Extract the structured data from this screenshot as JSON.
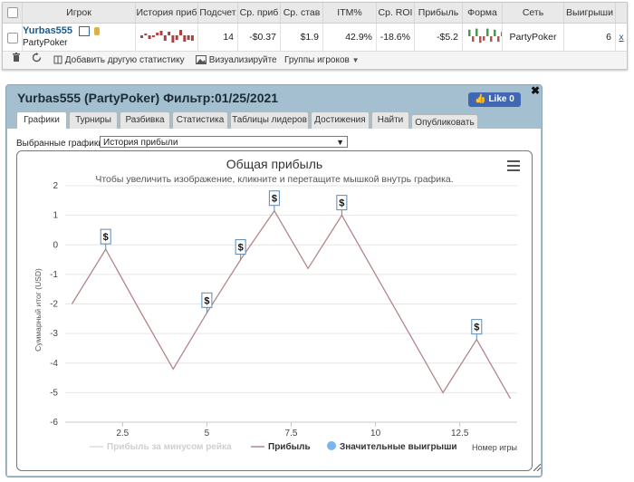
{
  "stats_table": {
    "headers": [
      "Игрок",
      "История приб",
      "Подсчет",
      "Ср. приб",
      "Ср. став",
      "ITM%",
      "Ср. ROI",
      "Прибыль",
      "Форма",
      "Сеть",
      "Выигрыши"
    ],
    "row": {
      "player_name": "Yurbas555",
      "player_network": "PartyPoker",
      "count": "14",
      "avg_profit": "-$0.37",
      "avg_stake": "$1.9",
      "itm": "42.9%",
      "avg_roi": "-18.6%",
      "profit": "-$5.2",
      "network": "PartyPoker",
      "wins": "6",
      "remove": "x"
    },
    "spark_history": [
      -0.3,
      0.2,
      -0.4,
      -0.2,
      0.3,
      0.5,
      -0.6,
      0.4,
      -0.8,
      -0.5,
      0.6,
      -0.7,
      -0.5,
      -0.6
    ],
    "form_bars": [
      0.6,
      -0.5,
      0.7,
      -0.6,
      -0.4,
      0.7,
      -0.5,
      0.6,
      -0.5,
      0.4
    ]
  },
  "toolbar": {
    "add_stats": "Добавить другую статистику",
    "visualize": "Визуализируйте",
    "player_groups": "Группы игроков"
  },
  "window": {
    "title": "Yurbas555 (PartyPoker) Фильтр:01/25/2021",
    "fb_like": "Like 0",
    "tabs": [
      "Графики",
      "Турниры",
      "Разбивка",
      "Статистика",
      "Таблицы лидеров",
      "Достижения",
      "Найти",
      "Опубликовать"
    ],
    "select_label": "Выбранные графики:",
    "select_value": "История прибыли"
  },
  "colors": {
    "line": "#b5848a",
    "accent": "#1f5a8a",
    "negative": "#c0504d",
    "form_pos": "#3aa040",
    "form_neg": "#c0504d",
    "spark": "#b04040"
  },
  "chart_data": {
    "type": "line",
    "title": "Общая прибыль",
    "subtitle": "Чтобы увеличить изображение, кликните и перетащите мышкой внутрь графика.",
    "xlabel": "Номер игры",
    "ylabel": "Суммарный итог (USD)",
    "xlim": [
      0.8,
      14.2
    ],
    "ylim": [
      -6,
      2
    ],
    "x_ticks": [
      "2.5",
      "5",
      "7.5",
      "10",
      "12.5"
    ],
    "x_tick_values": [
      2.5,
      5,
      7.5,
      10,
      12.5
    ],
    "y_ticks": [
      "2",
      "1",
      "0",
      "-1",
      "-2",
      "-3",
      "-4",
      "-5",
      "-6"
    ],
    "y_tick_values": [
      2,
      1,
      0,
      -1,
      -2,
      -3,
      -4,
      -5,
      -6
    ],
    "series": [
      {
        "name": "Прибыль",
        "x": [
          1,
          2,
          3,
          4,
          5,
          6,
          7,
          8,
          9,
          10,
          11,
          12,
          13,
          14
        ],
        "values": [
          -2.0,
          -0.15,
          -2.2,
          -4.2,
          -2.3,
          -0.5,
          1.15,
          -0.8,
          1.0,
          -1.0,
          -3.0,
          -5.0,
          -3.2,
          -5.2
        ]
      }
    ],
    "big_wins": {
      "name": "Значительные выигрыши",
      "marker": "$",
      "x": [
        2,
        5,
        6,
        7,
        9,
        13
      ],
      "y": [
        -0.15,
        -2.3,
        -0.5,
        1.15,
        1.0,
        -3.2
      ]
    },
    "legend": [
      "Прибыль за минусом рейка",
      "Прибыль",
      "Значительные выигрыши"
    ],
    "legend_position": "bottom",
    "grid": true
  }
}
